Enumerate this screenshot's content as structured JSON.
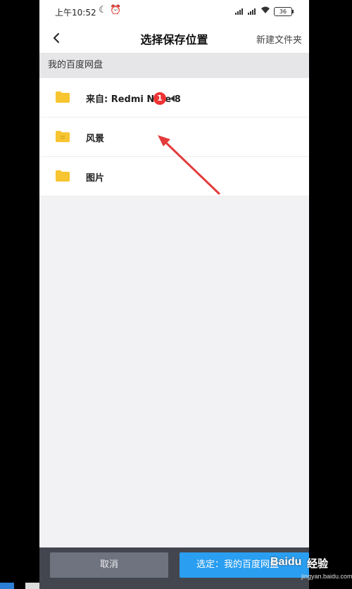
{
  "status_bar": {
    "time": "上午10:52",
    "moon_icon": "☾",
    "alarm_icon": "⏰",
    "wifi_icon": "wifi",
    "battery": "36"
  },
  "header": {
    "title": "选择保存位置",
    "new_folder_label": "新建文件夹"
  },
  "breadcrumb": "我的百度网盘",
  "folders": [
    {
      "label": "来自: Redmi Note 8",
      "icon": "folder-icon"
    },
    {
      "label": "风景",
      "icon": "folder-icon"
    },
    {
      "label": "图片",
      "icon": "folder-icon"
    }
  ],
  "annotation": {
    "badge_number": "1",
    "arrow_color": "#e33b3b"
  },
  "bottom_bar": {
    "cancel_label": "取消",
    "confirm_label": "选定：我的百度网盘"
  },
  "watermark": {
    "logo": "Baidu",
    "brand": "经验",
    "url": "jingyan.baidu.com"
  },
  "colors": {
    "accent": "#2a9ef0",
    "folder": "#f7c531",
    "cancel_bg": "#6f7380",
    "bottom_bg": "#44464f"
  }
}
